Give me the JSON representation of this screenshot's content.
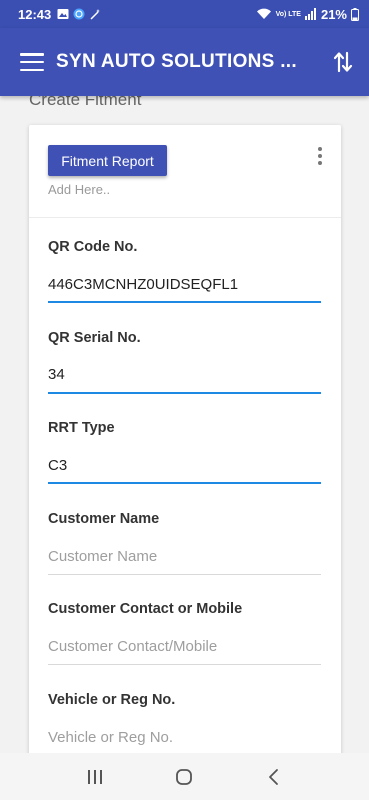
{
  "status_bar": {
    "time": "12:43",
    "battery": "21%",
    "network_label": "Vo) LTE"
  },
  "app_bar": {
    "title": "SYN AUTO SOLUTIONS ..."
  },
  "page": {
    "title": "Create Fitment"
  },
  "card": {
    "report_button": "Fitment Report",
    "add_here": "Add Here.."
  },
  "form": {
    "fields": [
      {
        "label": "QR Code No.",
        "value": "446C3MCNHZ0UIDSEQFL1",
        "placeholder": ""
      },
      {
        "label": "QR Serial No.",
        "value": "34",
        "placeholder": ""
      },
      {
        "label": "RRT Type",
        "value": "C3",
        "placeholder": ""
      },
      {
        "label": "Customer Name",
        "value": "",
        "placeholder": "Customer Name"
      },
      {
        "label": "Customer Contact or Mobile",
        "value": "",
        "placeholder": "Customer Contact/Mobile"
      },
      {
        "label": "Vehicle or Reg No.",
        "value": "",
        "placeholder": "Vehicle or Reg No."
      }
    ]
  },
  "colors": {
    "primary": "#3f51b5",
    "accent_underline": "#1e88e5"
  },
  "icons": {
    "menu": "hamburger-icon",
    "sort": "swap-vertical-icon",
    "overflow": "kebab-menu-icon",
    "nav_recents": "recents-icon",
    "nav_home": "home-icon",
    "nav_back": "back-icon"
  }
}
